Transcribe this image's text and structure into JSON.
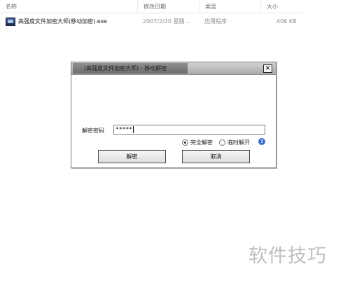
{
  "explorer": {
    "columns": [
      "名称",
      "修改日期",
      "类型",
      "大小"
    ],
    "file": {
      "name": "高强度文件加密大师(移动加密).exe",
      "modified": "2007/2/20 星期...",
      "type": "应用程序",
      "size": "406 KB"
    }
  },
  "dialog": {
    "title": "(高强度文件加密大师) - 移动解密",
    "close_label": "✕",
    "password_label": "解密密码",
    "password_value": "*****",
    "radio_full": "完全解密",
    "radio_temp": "临时解开",
    "help_label": "?",
    "decrypt_button": "解密",
    "cancel_button": "取消"
  },
  "watermark": "软件技巧"
}
